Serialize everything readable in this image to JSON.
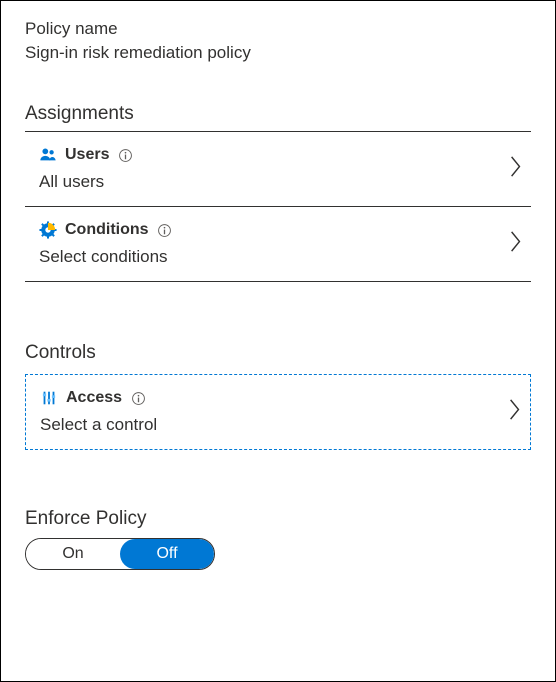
{
  "policy": {
    "name_label": "Policy name",
    "name_value": "Sign-in risk remediation policy"
  },
  "assignments": {
    "header": "Assignments",
    "users": {
      "title": "Users",
      "summary": "All users"
    },
    "conditions": {
      "title": "Conditions",
      "summary": "Select conditions"
    }
  },
  "controls": {
    "header": "Controls",
    "access": {
      "title": "Access",
      "summary": "Select a control"
    }
  },
  "enforce": {
    "label": "Enforce Policy",
    "on": "On",
    "off": "Off",
    "value": "Off"
  }
}
